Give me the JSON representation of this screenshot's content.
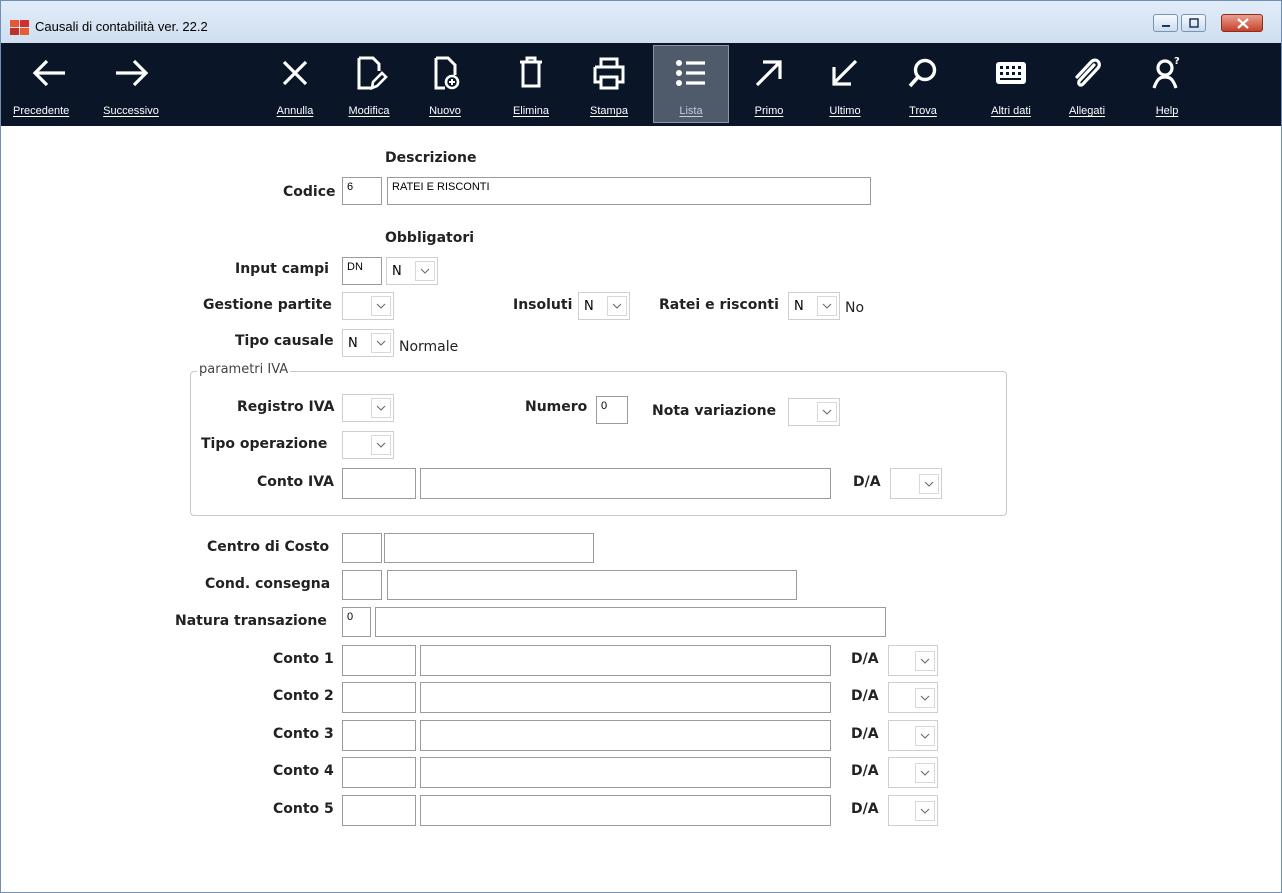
{
  "window": {
    "title": "Causali di contabilità ver. 22.2"
  },
  "toolbar": {
    "precedente": "Precedente",
    "successivo": "Successivo",
    "annulla": "Annulla",
    "modifica": "Modifica",
    "nuovo": "Nuovo",
    "elimina": "Elimina",
    "stampa": "Stampa",
    "lista": "Lista",
    "primo": "Primo",
    "ultimo": "Ultimo",
    "trova": "Trova",
    "altri_dati": "Altri dati",
    "allegati": "Allegati",
    "help": "Help"
  },
  "form": {
    "descrizione_header": "Descrizione",
    "codice_label": "Codice",
    "codice_value": "6",
    "descrizione_value": "RATEI E RISCONTI",
    "obbligatori_header": "Obbligatori",
    "input_campi_label": "Input campi",
    "input_campi_value": "DN",
    "input_campi_select": "N",
    "gestione_partite_label": "Gestione partite",
    "gestione_partite_select": "",
    "insoluti_label": "Insoluti",
    "insoluti_select": "N",
    "ratei_label": "Ratei e risconti",
    "ratei_select": "N",
    "ratei_desc": "No",
    "tipo_causale_label": "Tipo causale",
    "tipo_causale_select": "N",
    "tipo_causale_desc": "Normale",
    "iva_group_title": "parametri IVA",
    "registro_iva_label": "Registro IVA",
    "numero_label": "Numero",
    "numero_value": "0",
    "nota_variazione_label": "Nota variazione",
    "tipo_operazione_label": "Tipo operazione",
    "conto_iva_label": "Conto IVA",
    "da_label": "D/A",
    "centro_costo_label": "Centro di Costo",
    "cond_consegna_label": "Cond. consegna",
    "natura_label": "Natura transazione",
    "natura_value": "0",
    "conti": [
      {
        "label": "Conto 1"
      },
      {
        "label": "Conto 2"
      },
      {
        "label": "Conto 3"
      },
      {
        "label": "Conto 4"
      },
      {
        "label": "Conto 5"
      }
    ]
  }
}
